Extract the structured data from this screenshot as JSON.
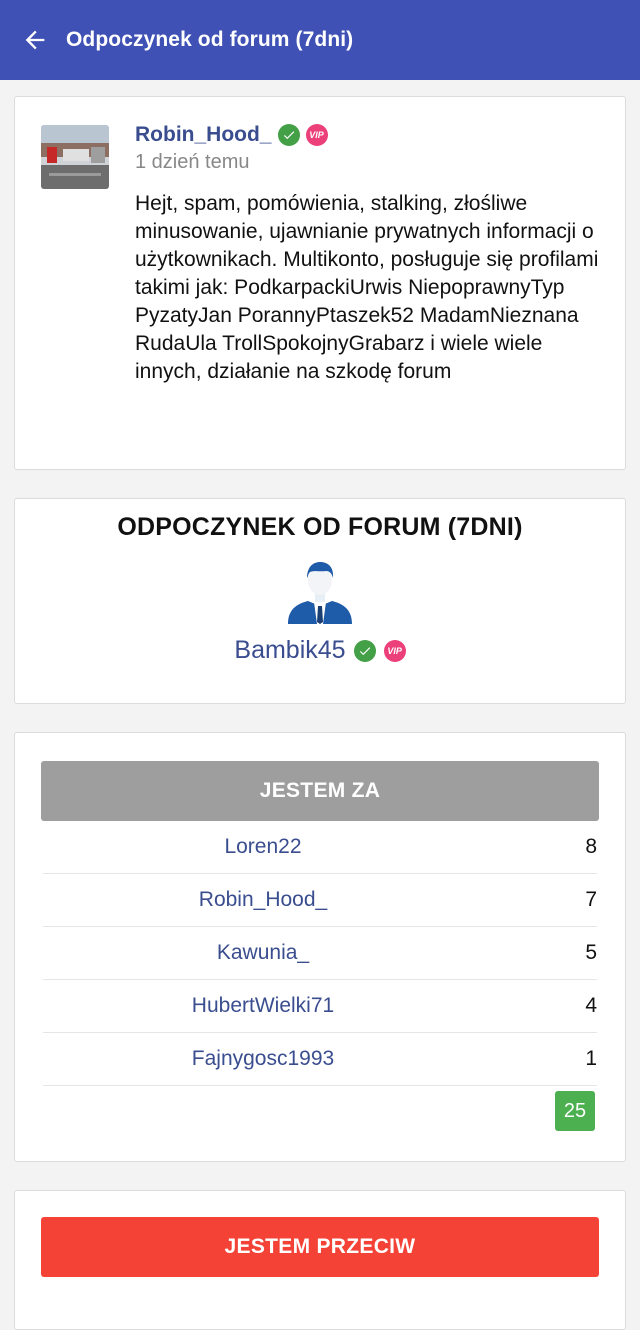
{
  "appbar": {
    "title": "Odpoczynek od forum (7dni)"
  },
  "post": {
    "author": "Robin_Hood_",
    "time": "1 dzień temu",
    "text": "Hejt, spam, pomówienia, stalking, złośliwe minusowanie, ujawnianie prywatnych informacji o użytkownikach. Multikonto, posługuje się profilami takimi jak: PodkarpackiUrwis NiepoprawnyTyp PyzatyJan PorannyPtaszek52 MadamNieznana RudaUla TrollSpokojnyGrabarz i wiele wiele innych, działanie na szkodę forum",
    "vip_label": "VIP"
  },
  "target": {
    "heading": "ODPOCZYNEK OD FORUM (7DNI)",
    "username": "Bambik45",
    "vip_label": "VIP"
  },
  "votes_for": {
    "button_label": "JESTEM ZA",
    "rows": [
      {
        "name": "Loren22",
        "count": "8"
      },
      {
        "name": "Robin_Hood_",
        "count": "7"
      },
      {
        "name": "Kawunia_",
        "count": "5"
      },
      {
        "name": "HubertWielki71",
        "count": "4"
      },
      {
        "name": "Fajnygosc1993",
        "count": "1"
      }
    ],
    "total": "25"
  },
  "votes_against": {
    "button_label": "JESTEM PRZECIW"
  },
  "colors": {
    "primary": "#3f51b5",
    "for": "#9e9e9e",
    "against": "#f44336",
    "total": "#4caf50",
    "link": "#3a4d8f"
  },
  "icons": {
    "back": "arrow-left-icon",
    "verified": "check-circle-icon",
    "vip": "vip-badge-icon",
    "person": "user-avatar-icon"
  }
}
